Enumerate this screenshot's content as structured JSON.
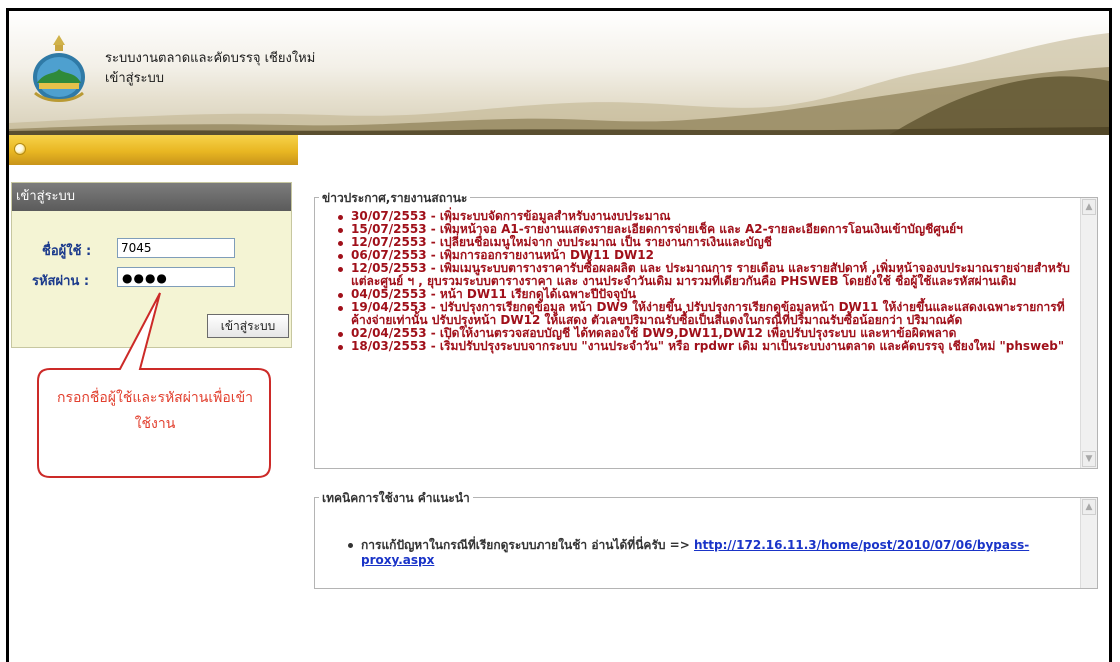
{
  "header": {
    "title": "ระบบงานตลาดและคัดบรรจุ เชียงใหม่",
    "subtitle": "เข้าสู่ระบบ"
  },
  "login": {
    "panel_title": "เข้าสู่ระบบ",
    "username_label": "ชื่อผู้ใช้ :",
    "username_value": "7045",
    "password_label": "รหัสผ่าน :",
    "password_mask": "●●●●",
    "submit_label": "เข้าสู่ระบบ"
  },
  "callout": {
    "line1": "กรอกชื่อผู้ใช้และรหัสผ่านเพื่อเข้า",
    "line2": "ใช้งาน"
  },
  "news": {
    "legend": "ข่าวประกาศ,รายงานสถานะ",
    "items": [
      "30/07/2553 - เพิ่มระบบจัดการข้อมูลสำหรับงานงบประมาณ",
      "15/07/2553 - เพิ่มหน้าจอ A1-รายงานแสดงรายละเอียดการจ่ายเช็ค และ A2-รายละเอียดการโอนเงินเข้าบัญชีศูนย์ฯ",
      "12/07/2553 - เปลี่ยนชื่อเมนูใหม่จาก งบประมาณ เป็น รายงานการเงินและบัญชี",
      "06/07/2553 - เพิ่มการออกรายงานหน้า DW11 DW12",
      "12/05/2553 - เพิ่มเมนูระบบตารางราคารับซื้อผลผลิต และ ประมาณการ รายเดือน และรายสัปดาห์ ,เพิ่มหน้าจองบประมาณรายจ่ายสำหรับแต่ละศูนย์ ฯ , ยุบรวมระบบตารางราคา และ งานประจำวันเดิม มารวมที่เดียวกันคือ PHSWEB โดยยังใช้ ชื่อผู้ใช้และรหัสผ่านเดิม",
      "04/05/2553 - หน้า DW11 เรียกดูได้เฉพาะปีปัจจุบัน",
      "19/04/2553 - ปรับปรุงการเรียกดูข้อมูล หน้า DW9 ให้ง่ายขึ้น ปรับปรุงการเรียกดูข้อมูลหน้า DW11 ให้ง่ายขึ้นและแสดงเฉพาะรายการที่ค้างจ่ายเท่านั้น ปรับปรุงหน้า DW12 ให้แสดง ตัวเลขปริมาณรับซื้อเป็นสีแดงในกรณีที่ปริมาณรับซื้อน้อยกว่า ปริมาณคัด",
      "02/04/2553 - เปิดให้งานตรวจสอบบัญชี ได้ทดลองใช้ DW9,DW11,DW12 เพื่อปรับปรุงระบบ และหาข้อผิดพลาด",
      "18/03/2553 - เริ่มปรับปรุงระบบจากระบบ \"งานประจำวัน\" หรือ rpdwr เดิม มาเป็นระบบงานตลาด และคัดบรรจุ เชียงใหม่ \"phsweb\""
    ]
  },
  "tips": {
    "legend": "เทคนิคการใช้งาน คำแนะนำ",
    "item_text": "การแก้ปัญหาในกรณีที่เรียกดูระบบภายในช้า อ่านได้ที่นี่ครับ => ",
    "item_link": "http://172.16.11.3/home/post/2010/07/06/bypass-proxy.aspx"
  },
  "icons": {
    "logo": "organization-seal-logo",
    "radio": "radio-icon",
    "scroll_up": "scroll-up-arrow-icon",
    "scroll_down": "scroll-down-arrow-icon"
  },
  "colors": {
    "news_text": "#a0101a",
    "link": "#1a34c8",
    "callout": "#e2402f",
    "label": "#1b3a8c"
  }
}
